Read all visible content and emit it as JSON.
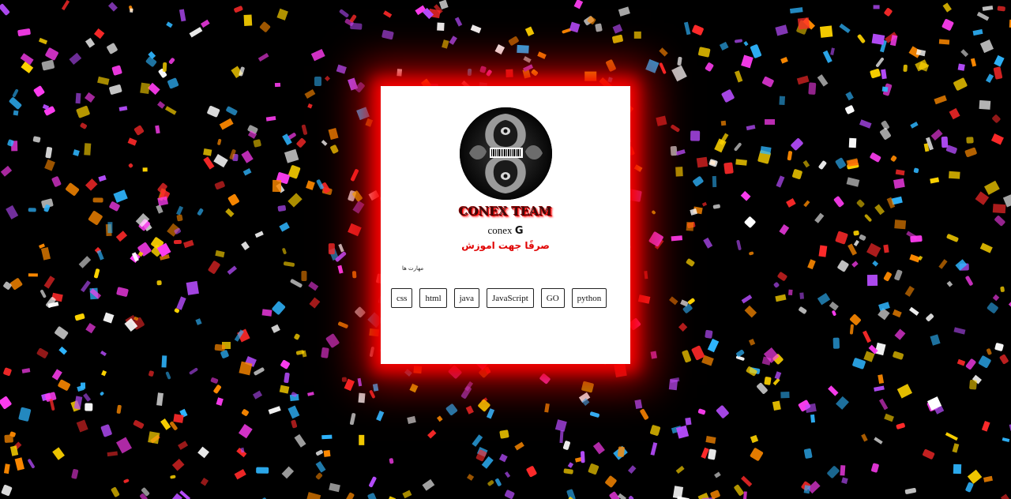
{
  "profile": {
    "team_name": "CONEX TEAM",
    "handle": "conex",
    "handle_logo": "G",
    "tagline": "صرفًا جهت اموزش",
    "avatar_icon": "hooded-figure-barcode-icon"
  },
  "skills": {
    "title": "مهارت ها",
    "items": [
      {
        "label": "css"
      },
      {
        "label": "html"
      },
      {
        "label": "java"
      },
      {
        "label": "JavaScript"
      },
      {
        "label": "GO"
      },
      {
        "label": "python"
      }
    ]
  },
  "theme": {
    "background": "#000000",
    "card": "#ffffff",
    "glow": "#ff0000",
    "accent_text": "#e00000",
    "confetti_colors": [
      "#ff2a2a",
      "#ffd400",
      "#ff3df2",
      "#2fb6ff",
      "#ffffff",
      "#ff8a00",
      "#b84dff"
    ]
  }
}
